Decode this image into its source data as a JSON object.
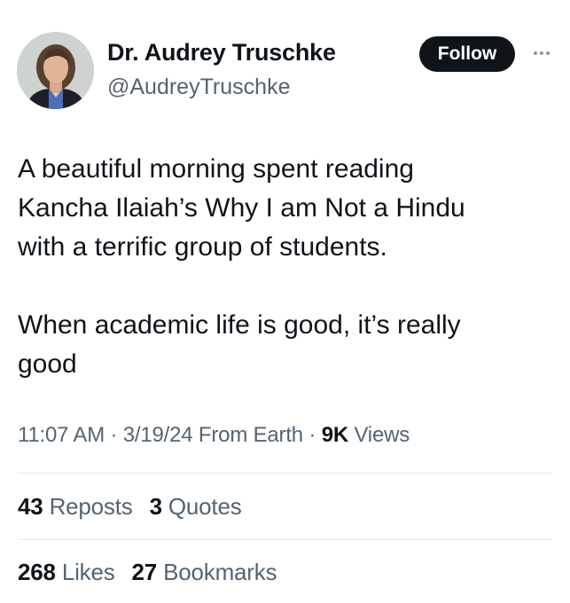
{
  "author": {
    "name": "Dr. Audrey Truschke",
    "handle": "@AudreyTruschke"
  },
  "follow_label": "Follow",
  "tweet": {
    "line1": "A beautiful morning spent reading",
    "line2": "Kancha Ilaiah’s Why I am Not a Hindu",
    "line3": "with a terrific group of students.",
    "line4": "When academic life is good, it’s really",
    "line5": "good"
  },
  "meta": {
    "time": "11:07 AM",
    "date": "3/19/24",
    "source": "From Earth",
    "views_count": "9K",
    "views_label": "Views"
  },
  "engagement": {
    "reposts_count": "43",
    "reposts_label": "Reposts",
    "quotes_count": "3",
    "quotes_label": "Quotes",
    "likes_count": "268",
    "likes_label": "Likes",
    "bookmarks_count": "27",
    "bookmarks_label": "Bookmarks"
  },
  "icons": {
    "more": "more-options-icon",
    "avatar": "profile-photo"
  },
  "colors": {
    "text_primary": "#0f1419",
    "text_secondary": "#536471",
    "follow_bg": "#0f1419",
    "divider": "#e6e9eb"
  }
}
